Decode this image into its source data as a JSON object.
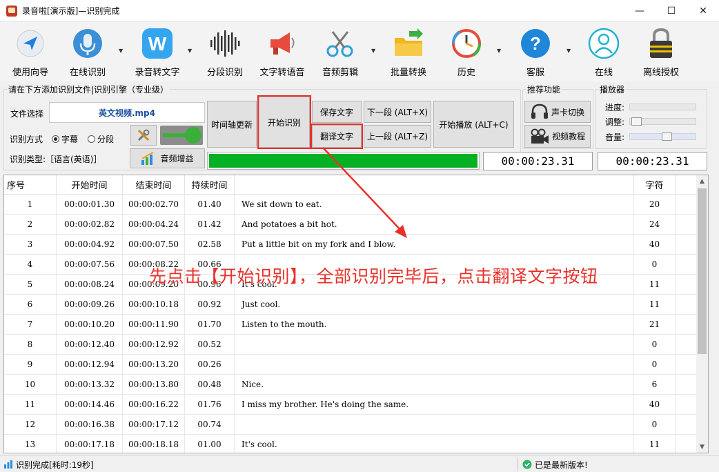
{
  "window": {
    "title": "录音啦[演示版]—识别完成",
    "controls": {
      "minimize": "—",
      "maximize": "☐",
      "close": "✕"
    }
  },
  "toolbar": {
    "items": [
      {
        "label": "使用向导",
        "icon": "navigation-arrow-icon"
      },
      {
        "label": "在线识别",
        "icon": "microphone-icon"
      },
      {
        "label": "录音转文字",
        "icon": "w-logo-icon"
      },
      {
        "label": "分段识别",
        "icon": "waveform-icon"
      },
      {
        "label": "文字转语音",
        "icon": "megaphone-icon"
      },
      {
        "label": "音频剪辑",
        "icon": "scissors-icon"
      },
      {
        "label": "批量转换",
        "icon": "folder-icon"
      },
      {
        "label": "历史",
        "icon": "history-clock-icon"
      },
      {
        "label": "客服",
        "icon": "help-question-icon"
      },
      {
        "label": "在线",
        "icon": "user-icon"
      },
      {
        "label": "离线授权",
        "icon": "lock-icon"
      }
    ]
  },
  "file_group": {
    "title": "请在下方添加识别文件|识别引擎（专业级）",
    "file_label": "文件选择",
    "file_name": "英文视频.mp4",
    "mode_label": "识别方式",
    "mode_options": [
      "字幕",
      "分段"
    ],
    "mode_selected": "字幕",
    "type_label": "识别类型:［语言(英语)］",
    "audio_boost": "音频增益"
  },
  "actions": {
    "timeline_update": "时间轴更新",
    "start_recognition": "开始识别",
    "save_text": "保存文字",
    "translate_text": "翻译文字",
    "next_segment": "下一段 (ALT+X)",
    "prev_segment": "上一段 (ALT+Z)",
    "start_play": "开始播放 (ALT+C)"
  },
  "progress": {
    "fraction": 1.0,
    "time_left": "00:00:23.31",
    "time_right": "00:00:23.31"
  },
  "recommend": {
    "title": "推荐功能",
    "sound_card": "声卡切换",
    "video_tutorial": "视频教程"
  },
  "player": {
    "title": "播放器",
    "progress_label": "进度:",
    "adjust_label": "调整:",
    "volume_label": "音量:",
    "adjust_level": 0.02,
    "volume_level": 0.57
  },
  "table": {
    "columns": [
      "序号",
      "开始时间",
      "结束时间",
      "持续时间",
      "",
      "字符"
    ],
    "rows": [
      {
        "no": "1",
        "start": "00:00:01.30",
        "end": "00:00:02.70",
        "dur": "01.40",
        "text": "We sit down to eat.",
        "chars": "20"
      },
      {
        "no": "2",
        "start": "00:00:02.82",
        "end": "00:00:04.24",
        "dur": "01.42",
        "text": "And potatoes a bit hot.",
        "chars": "24"
      },
      {
        "no": "3",
        "start": "00:00:04.92",
        "end": "00:00:07.50",
        "dur": "02.58",
        "text": "Put a little bit on my fork and I blow.",
        "chars": "40"
      },
      {
        "no": "4",
        "start": "00:00:07.56",
        "end": "00:00:08.22",
        "dur": "00.66",
        "text": "",
        "chars": "0"
      },
      {
        "no": "5",
        "start": "00:00:08.24",
        "end": "00:00:09.20",
        "dur": "00.96",
        "text": "It's cool.",
        "chars": "11"
      },
      {
        "no": "6",
        "start": "00:00:09.26",
        "end": "00:00:10.18",
        "dur": "00.92",
        "text": "Just cool.",
        "chars": "11"
      },
      {
        "no": "7",
        "start": "00:00:10.20",
        "end": "00:00:11.90",
        "dur": "01.70",
        "text": "Listen to the mouth.",
        "chars": "21"
      },
      {
        "no": "8",
        "start": "00:00:12.40",
        "end": "00:00:12.92",
        "dur": "00.52",
        "text": "",
        "chars": "0"
      },
      {
        "no": "9",
        "start": "00:00:12.94",
        "end": "00:00:13.20",
        "dur": "00.26",
        "text": "",
        "chars": "0"
      },
      {
        "no": "10",
        "start": "00:00:13.32",
        "end": "00:00:13.80",
        "dur": "00.48",
        "text": "Nice.",
        "chars": "6"
      },
      {
        "no": "11",
        "start": "00:00:14.46",
        "end": "00:00:16.22",
        "dur": "01.76",
        "text": "I miss my brother. He's doing the same.",
        "chars": "40"
      },
      {
        "no": "12",
        "start": "00:00:16.38",
        "end": "00:00:17.12",
        "dur": "00.74",
        "text": "",
        "chars": "0"
      },
      {
        "no": "13",
        "start": "00:00:17.18",
        "end": "00:00:18.18",
        "dur": "01.00",
        "text": "It's cool.",
        "chars": "11"
      }
    ]
  },
  "annotation": "先点击【开始识别】，全部识别完毕后，点击翻译文字按钮",
  "status": {
    "left": "识别完成[耗时:19秒]",
    "right": "已是最新版本!"
  },
  "colors": {
    "accent_red": "#e8302a",
    "progress_green": "#06b025",
    "file_blue": "#1a4fa0"
  }
}
